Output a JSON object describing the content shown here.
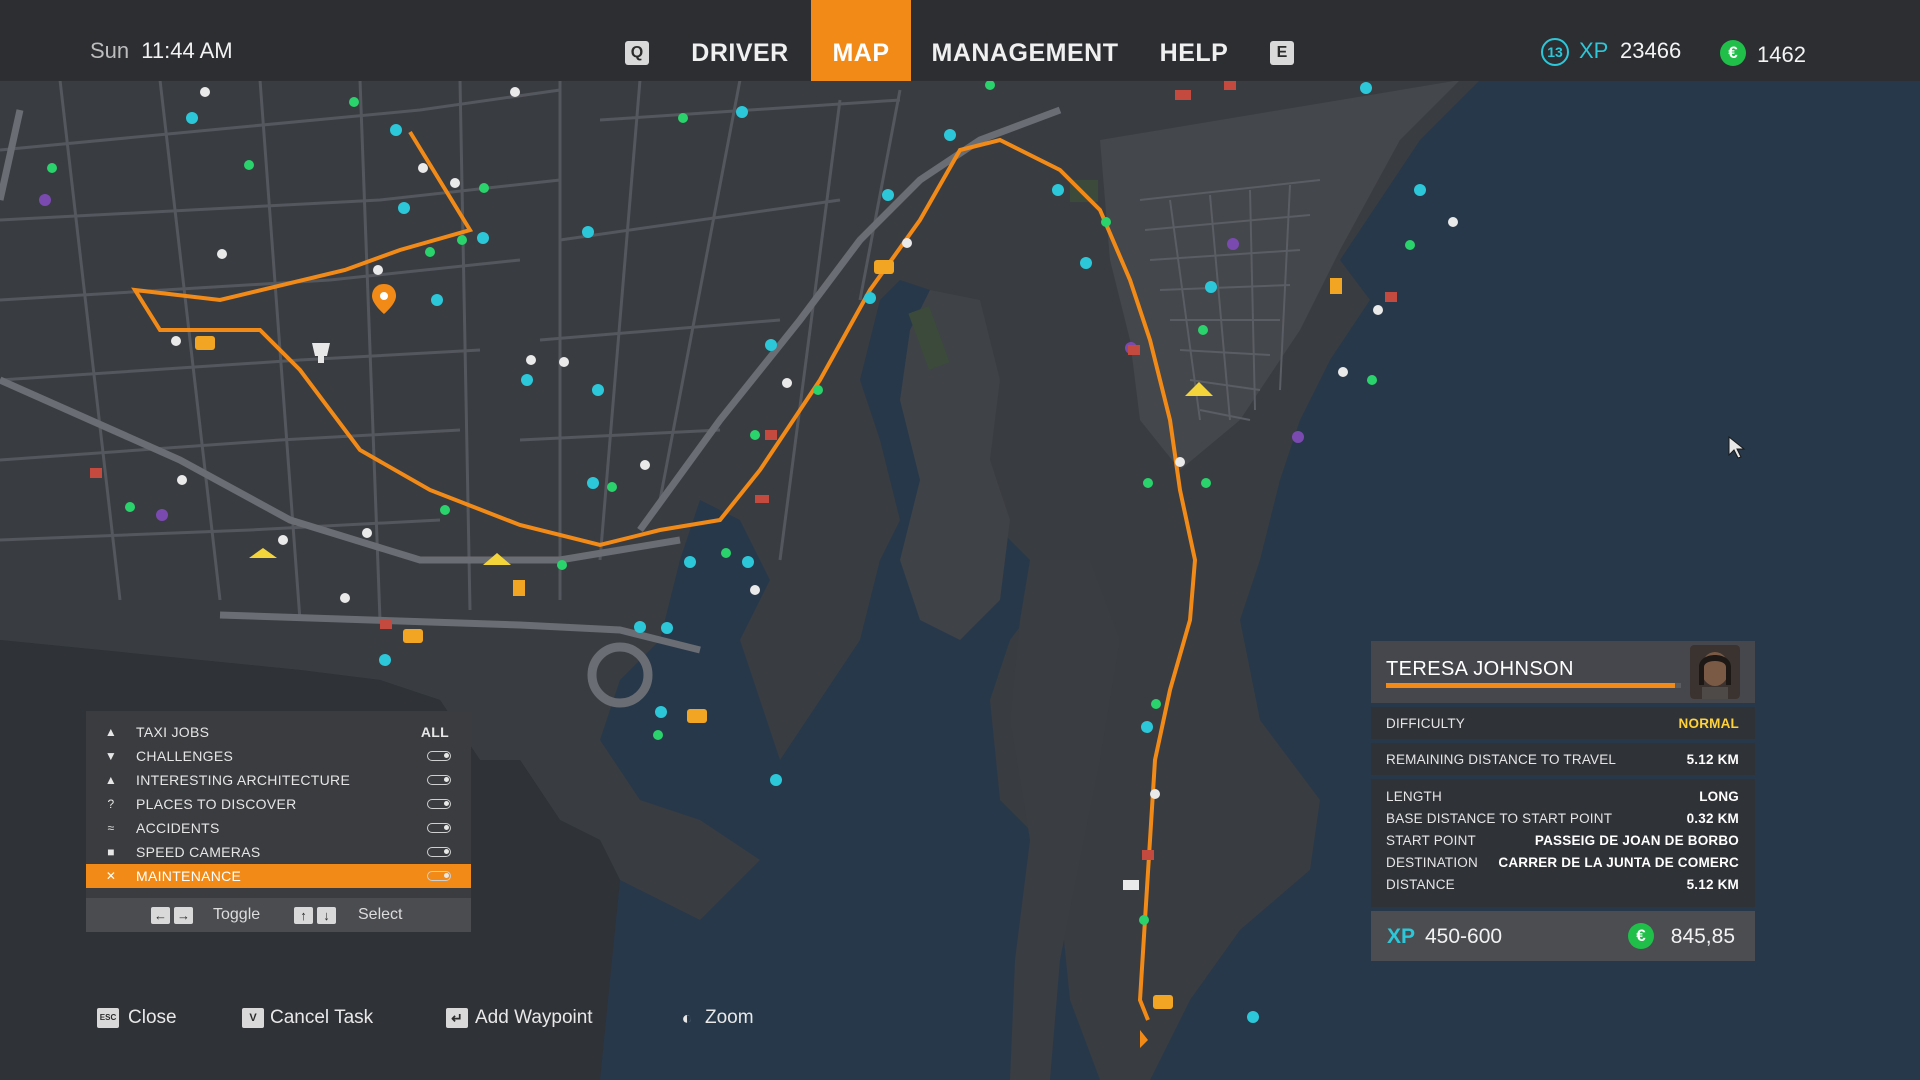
{
  "header": {
    "day": "Sun",
    "time": "11:44 AM",
    "key_left": "Q",
    "key_right": "E",
    "tabs": [
      {
        "label": "DRIVER",
        "active": false
      },
      {
        "label": "MAP",
        "active": true
      },
      {
        "label": "MANAGEMENT",
        "active": false
      },
      {
        "label": "HELP",
        "active": false
      }
    ],
    "level": "13",
    "xp_label": "XP",
    "xp_value": "23466",
    "currency_symbol": "€",
    "money": "1462"
  },
  "filters": {
    "items": [
      {
        "icon": "person-icon",
        "label": "TAXI JOBS",
        "value": "ALL"
      },
      {
        "icon": "trophy-icon",
        "label": "CHALLENGES"
      },
      {
        "icon": "monument-icon",
        "label": "INTERESTING ARCHITECTURE"
      },
      {
        "icon": "question-icon",
        "label": "PLACES TO DISCOVER"
      },
      {
        "icon": "accident-icon",
        "label": "ACCIDENTS"
      },
      {
        "icon": "camera-icon",
        "label": "SPEED CAMERAS"
      },
      {
        "icon": "wrench-icon",
        "label": "MAINTENANCE",
        "selected": true
      }
    ],
    "hint_toggle": "Toggle",
    "hint_select": "Select",
    "key_left": "←",
    "key_right": "→",
    "key_up": "↑",
    "key_down": "↓"
  },
  "bottom_hints": [
    {
      "key": "ESC",
      "label": "Close"
    },
    {
      "key": "V",
      "label": "Cancel Task"
    },
    {
      "key": "↵",
      "label": "Add Waypoint"
    },
    {
      "key": "◐",
      "label": "Zoom"
    }
  ],
  "job_card": {
    "passenger": "TERESA JOHNSON",
    "progress": 0.98,
    "difficulty_label": "DIFFICULTY",
    "difficulty_value": "NORMAL",
    "remaining_label": "REMAINING DISTANCE TO TRAVEL",
    "remaining_value": "5.12 KM",
    "length_label": "LENGTH",
    "length_value": "LONG",
    "base_label": "BASE DISTANCE TO START POINT",
    "base_value": "0.32 KM",
    "start_label": "START POINT",
    "start_value": "PASSEIG DE JOAN DE BORBO",
    "dest_label": "DESTINATION",
    "dest_value": "CARRER DE LA JUNTA DE COMERC",
    "distance_label": "DISTANCE",
    "distance_value": "5.12 KM",
    "xp_label": "XP",
    "xp_value": "450-600",
    "reward": "845,85"
  },
  "colors": {
    "accent": "#f28a17",
    "xp": "#2cc7d8",
    "money": "#1fbf4a",
    "difficulty": "#ffd23a",
    "water": "#27384a",
    "land": "#393c41",
    "route": "#f28a17"
  }
}
